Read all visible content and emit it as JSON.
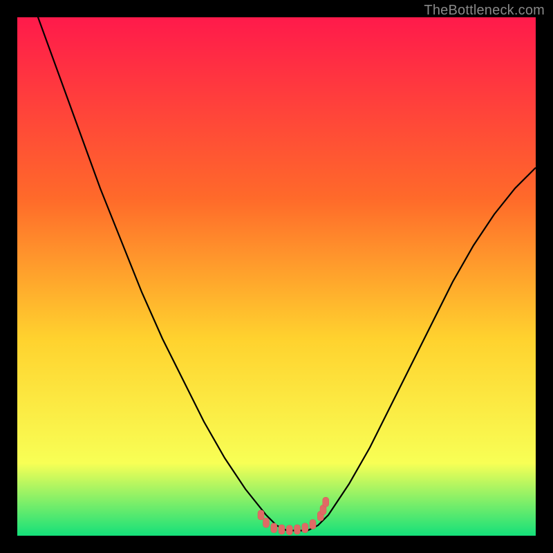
{
  "watermark": "TheBottleneck.com",
  "colors": {
    "bg": "#000000",
    "grad_top": "#ff1a4b",
    "grad_mid1": "#ff6a2a",
    "grad_mid2": "#ffd22e",
    "grad_mid3": "#f8ff55",
    "grad_bottom": "#14e07a",
    "curve": "#000000",
    "marker_fill": "#e06a65",
    "marker_stroke": "#d65c57",
    "watermark": "#888888"
  },
  "chart_data": {
    "type": "line",
    "title": "",
    "xlabel": "",
    "ylabel": "",
    "xlim": [
      0,
      100
    ],
    "ylim": [
      0,
      100
    ],
    "series": [
      {
        "name": "bottleneck-curve",
        "x": [
          0,
          4,
          8,
          12,
          16,
          20,
          24,
          28,
          32,
          36,
          40,
          44,
          48,
          50,
          52,
          54,
          56,
          58,
          60,
          64,
          68,
          72,
          76,
          80,
          84,
          88,
          92,
          96,
          100
        ],
        "y": [
          112,
          100,
          89,
          78,
          67,
          57,
          47,
          38,
          30,
          22,
          15,
          9,
          4,
          2,
          1,
          1,
          1,
          2,
          4,
          10,
          17,
          25,
          33,
          41,
          49,
          56,
          62,
          67,
          71
        ]
      }
    ],
    "markers": [
      {
        "x": 47.0,
        "y": 4.0
      },
      {
        "x": 48.0,
        "y": 2.5
      },
      {
        "x": 49.5,
        "y": 1.5
      },
      {
        "x": 51.0,
        "y": 1.2
      },
      {
        "x": 52.5,
        "y": 1.1
      },
      {
        "x": 54.0,
        "y": 1.2
      },
      {
        "x": 55.5,
        "y": 1.5
      },
      {
        "x": 57.0,
        "y": 2.2
      },
      {
        "x": 58.5,
        "y": 3.8
      },
      {
        "x": 59.0,
        "y": 5.0
      },
      {
        "x": 59.5,
        "y": 6.5
      }
    ]
  }
}
